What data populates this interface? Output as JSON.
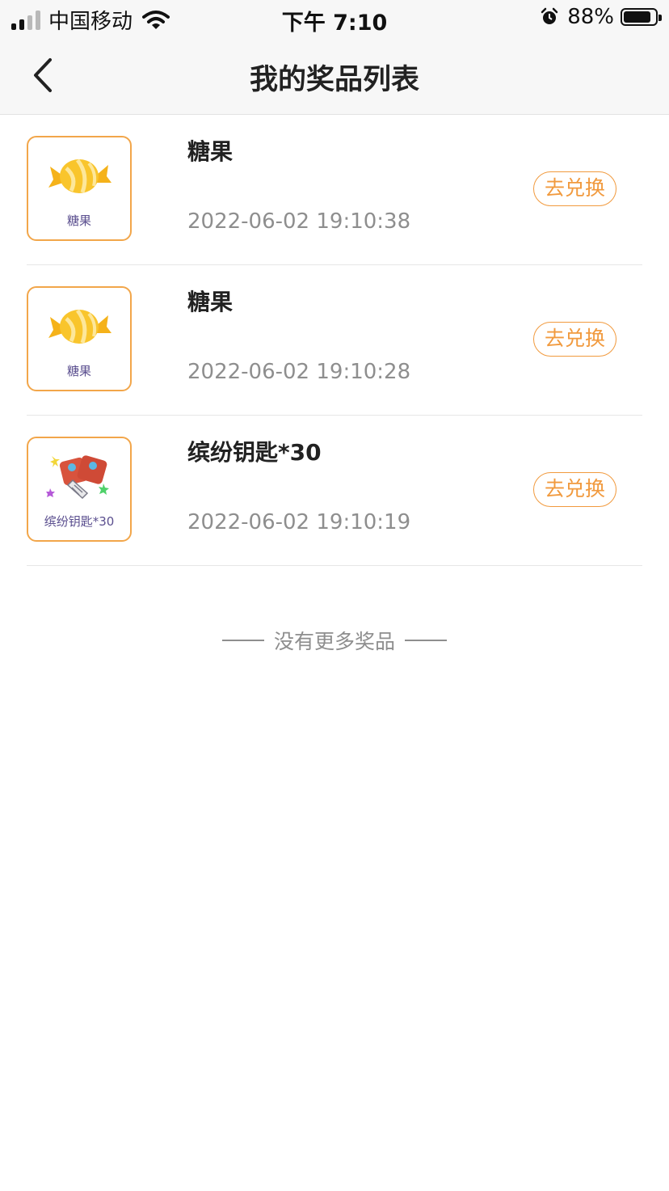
{
  "status_bar": {
    "carrier": "中国移动",
    "time": "下午 7:10",
    "battery_percent": "88%",
    "battery_level": 0.88,
    "signal_bars_active": 2,
    "signal_bars_total": 4
  },
  "header": {
    "title": "我的奖品列表",
    "back_icon": "chevron-left-icon"
  },
  "prizes": [
    {
      "name": "糖果",
      "thumb_caption": "糖果",
      "icon": "candy-icon",
      "date": "2022-06-02 19:10:38",
      "action_label": "去兑换"
    },
    {
      "name": "糖果",
      "thumb_caption": "糖果",
      "icon": "candy-icon",
      "date": "2022-06-02 19:10:28",
      "action_label": "去兑换"
    },
    {
      "name": "缤纷钥匙*30",
      "thumb_caption": "缤纷钥匙*30",
      "icon": "key-icon",
      "date": "2022-06-02 19:10:19",
      "action_label": "去兑换"
    }
  ],
  "footer": {
    "no_more_text": "没有更多奖品"
  },
  "colors": {
    "accent": "#f19a3e",
    "thumb_border": "#f2a64a",
    "caption": "#5b4f8f",
    "muted_text": "#8e8e8e",
    "header_bg": "#f7f7f7"
  }
}
